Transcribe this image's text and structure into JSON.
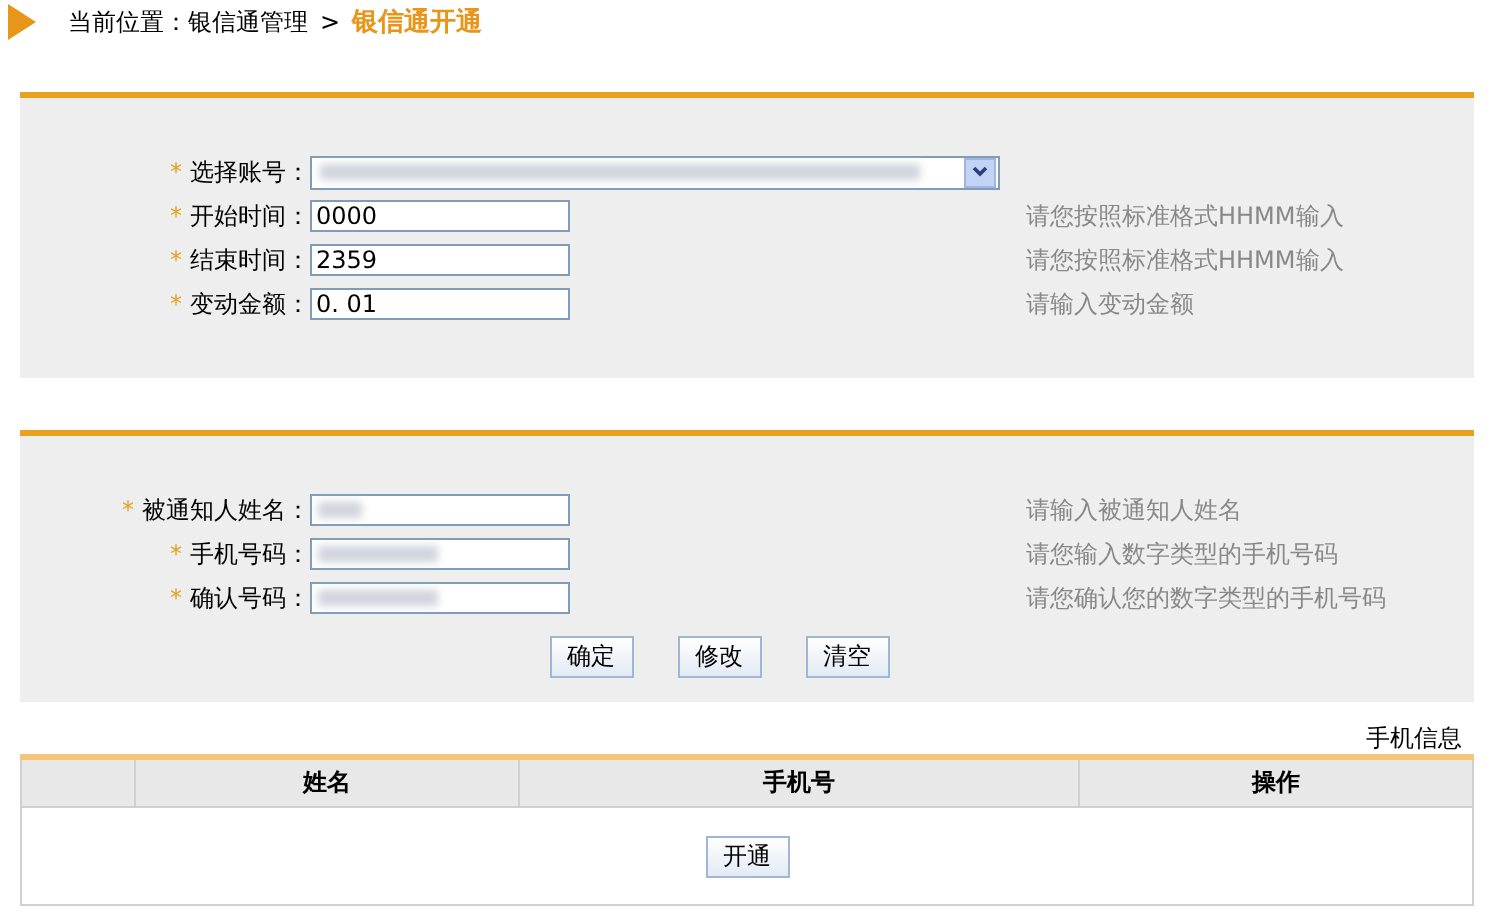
{
  "breadcrumb": {
    "prefix": "当前位置：银信通管理",
    "separator": ">",
    "current": "银信通开通"
  },
  "account_section": {
    "rows": [
      {
        "kind": "select",
        "label": "选择账号：",
        "marker": "*"
      },
      {
        "kind": "text",
        "label": "开始时间：",
        "marker": "*",
        "value": "0000",
        "hint": "请您按照标准格式HHMM输入"
      },
      {
        "kind": "text",
        "label": "结束时间：",
        "marker": "*",
        "value": "2359",
        "hint": "请您按照标准格式HHMM输入"
      },
      {
        "kind": "text",
        "label": "变动金额：",
        "marker": "*",
        "value": "0. 01",
        "hint": "请输入变动金额"
      }
    ]
  },
  "contact_section": {
    "rows": [
      {
        "kind": "blurred",
        "label": "被通知人姓名：",
        "marker": "*",
        "hint": "请输入被通知人姓名"
      },
      {
        "kind": "blurred",
        "label": "手机号码：",
        "marker": "*",
        "hint": "请您输入数字类型的手机号码"
      },
      {
        "kind": "blurred",
        "label": "确认号码：",
        "marker": "*",
        "hint": "请您确认您的数字类型的手机号码"
      }
    ],
    "buttons": [
      "确定",
      "修改",
      "清空"
    ]
  },
  "phone_table": {
    "caption": "手机信息",
    "columns": [
      "",
      "姓名",
      "手机号",
      "操作"
    ],
    "action_button": "开通"
  }
}
